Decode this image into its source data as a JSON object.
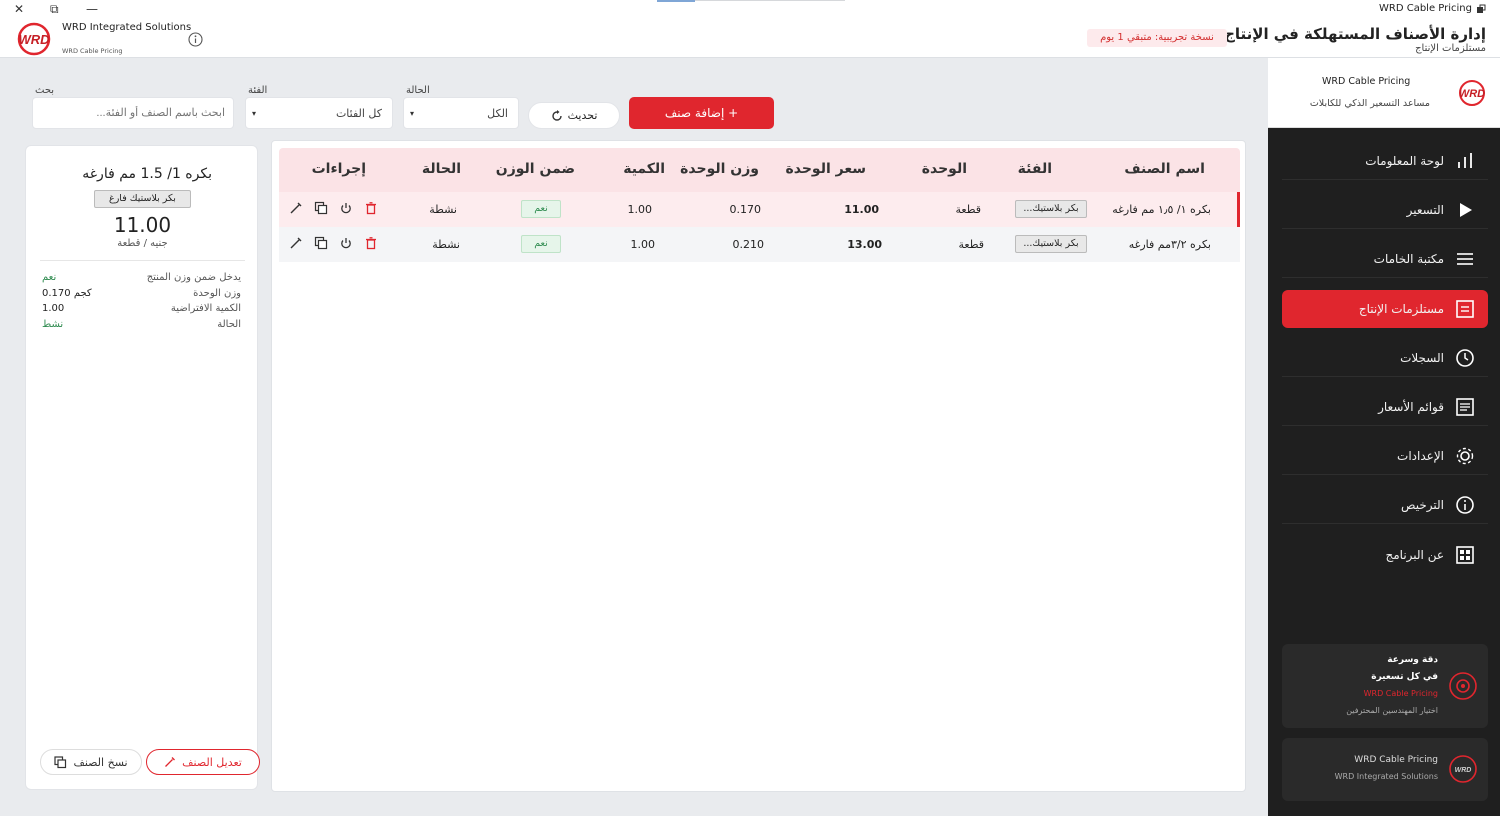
{
  "window": {
    "close": "✕",
    "restore": "⧉",
    "minimize": "—"
  },
  "header": {
    "brand_name": "WRD Integrated Solutions",
    "brand_sub": "WRD Cable Pricing",
    "app_name": "WRD Cable Pricing",
    "title": "إدارة الأصناف المستهلكة في الإنتاج",
    "subtitle": "مستلزمات الإنتاج",
    "trial_badge": "نسخة تجريبية: متبقي 1 يوم"
  },
  "sidebar": {
    "app_name": "WRD Cable Pricing",
    "tagline": "مساعد التسعير الذكي للكابلات",
    "items": [
      {
        "label": "لوحة المعلومات",
        "icon": "bar-chart-icon"
      },
      {
        "label": "التسعير",
        "icon": "play-icon"
      },
      {
        "label": "مكتبة الخامات",
        "icon": "menu-icon"
      },
      {
        "label": "مستلزمات الإنتاج",
        "icon": "document-icon"
      },
      {
        "label": "السجلات",
        "icon": "clock-icon"
      },
      {
        "label": "قوائم الأسعار",
        "icon": "list-icon"
      },
      {
        "label": "الإعدادات",
        "icon": "gear-icon"
      },
      {
        "label": "الترخيص",
        "icon": "info-icon"
      },
      {
        "label": "عن البرنامج",
        "icon": "grid-icon"
      }
    ],
    "promo": {
      "line1": "دقة وسرعة",
      "line2": "في كل تسعيرة",
      "line3": "WRD Cable Pricing",
      "line4": "اختيار المهندسين المحترفين"
    },
    "footer": {
      "line1": "WRD Cable Pricing",
      "line2": "WRD Integrated Solutions"
    }
  },
  "filters": {
    "search_label": "بحث",
    "search_placeholder": "ابحث باسم الصنف أو الفئة...",
    "category_label": "الفئة",
    "category_value": "كل الفئات",
    "status_label": "الحالة",
    "status_value": "الكل",
    "refresh_label": "تحديث",
    "add_label": "+ إضافة صنف"
  },
  "table": {
    "headers": {
      "name": "اسم الصنف",
      "category": "الفئة",
      "unit": "الوحدة",
      "price": "سعر الوحدة",
      "weight": "وزن الوحدة",
      "qty": "الكمية",
      "in_weight": "ضمن الوزن",
      "status": "الحالة",
      "actions": "إجراءات"
    },
    "rows": [
      {
        "name": "بكره ١/ ١٫٥ مم فارغه",
        "category": "بكر بلاستيك...",
        "unit": "قطعة",
        "price": "11.00",
        "weight": "0.170",
        "qty": "1.00",
        "in_weight": "نعم",
        "status": "نشطة"
      },
      {
        "name": "بكره ٣/٢مم فارغه",
        "category": "بكر بلاستيك...",
        "unit": "قطعة",
        "price": "13.00",
        "weight": "0.210",
        "qty": "1.00",
        "in_weight": "نعم",
        "status": "نشطة"
      }
    ]
  },
  "detail": {
    "title": "بكره 1/ 1.5 مم فارغه",
    "category": "بكر بلاستيك فارغ",
    "price": "11.00",
    "unit": "جنيه / قطعة",
    "fields": [
      {
        "key": "يدخل ضمن وزن المنتج",
        "value": "نعم",
        "color": "#2e8b4f"
      },
      {
        "key": "وزن الوحدة",
        "value": "0.170 كجم",
        "color": "#222222"
      },
      {
        "key": "الكمية الافتراضية",
        "value": "1.00",
        "color": "#222222"
      },
      {
        "key": "الحالة",
        "value": "نشط",
        "color": "#2e8b4f"
      }
    ],
    "edit_label": "تعديل الصنف",
    "copy_label": "نسخ الصنف"
  },
  "colors": {
    "accent": "#e0262e",
    "sidebar": "#1f1f1f",
    "success": "#2e8b4f"
  }
}
